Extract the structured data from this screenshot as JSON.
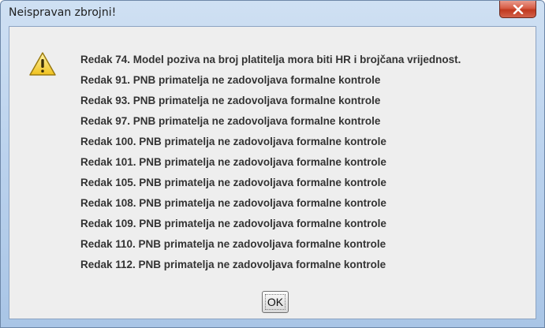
{
  "window": {
    "title": "Neispravan zbrojni!"
  },
  "dialog": {
    "icon": "warning-icon",
    "messages": [
      "Redak 74. Model poziva na broj platitelja mora biti HR i brojčana vrijednost.",
      "Redak 91. PNB primatelja ne zadovoljava formalne kontrole",
      "Redak 93. PNB primatelja ne zadovoljava formalne kontrole",
      "Redak 97. PNB primatelja ne zadovoljava formalne kontrole",
      "Redak 100. PNB primatelja ne zadovoljava formalne kontrole",
      "Redak 101. PNB primatelja ne zadovoljava formalne kontrole",
      "Redak 105. PNB primatelja ne zadovoljava formalne kontrole",
      "Redak 108. PNB primatelja ne zadovoljava formalne kontrole",
      "Redak 109. PNB primatelja ne zadovoljava formalne kontrole",
      "Redak 110. PNB primatelja ne zadovoljava formalne kontrole",
      "Redak 112. PNB primatelja ne zadovoljava formalne kontrole"
    ],
    "ok_label": "OK"
  },
  "colors": {
    "title_bar": "#bcd3ee",
    "close_button": "#c0391f",
    "client_background": "#eeeeee",
    "warning_fill": "#f7d54a",
    "message_text": "#333333"
  }
}
